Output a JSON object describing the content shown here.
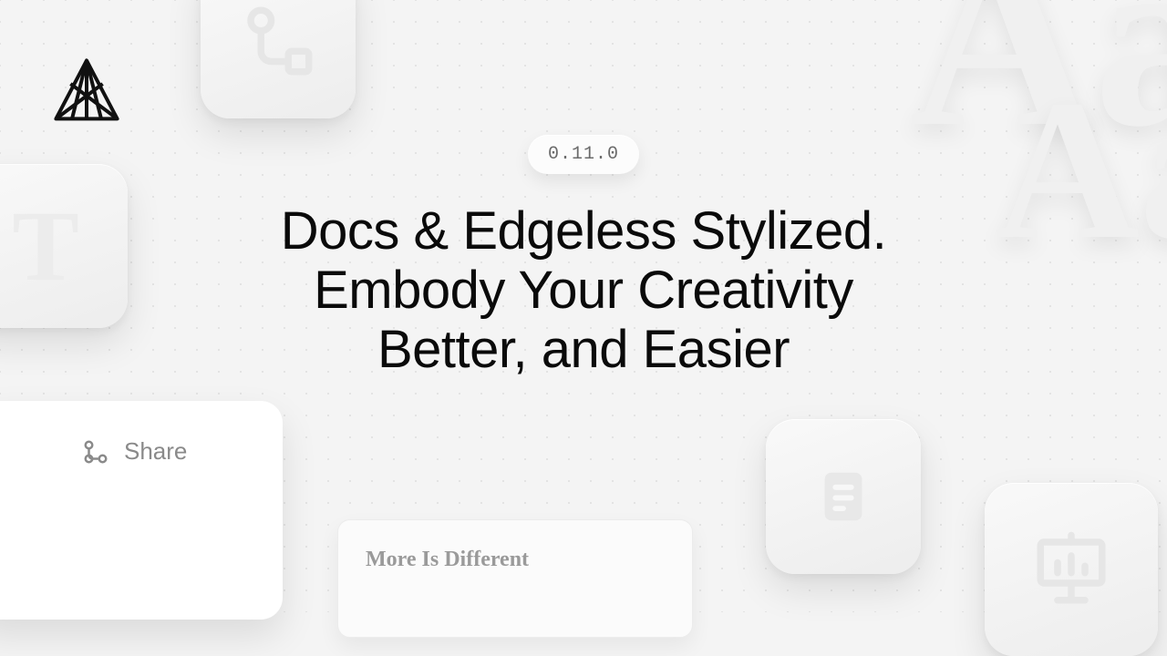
{
  "version": "0.11.0",
  "headline_l1": "Docs & Edgeless Stylized.",
  "headline_l2": "Embody Your Creativity",
  "headline_l3": "Better, and Easier",
  "share_label": "Share",
  "card_title": "More Is Different",
  "deco": {
    "aa": "Aa",
    "t": "T"
  }
}
